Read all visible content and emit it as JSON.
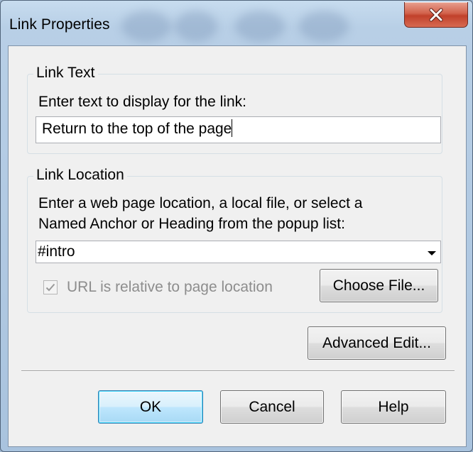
{
  "window": {
    "title": "Link Properties"
  },
  "link_text_group": {
    "title": "Link Text",
    "prompt": "Enter text to display for the link:",
    "value": "Return to the top of the page"
  },
  "link_location_group": {
    "title": "Link Location",
    "prompt_line1": "Enter a web page location, a local file, or select a",
    "prompt_line2": "Named Anchor or Heading from the popup list:",
    "location_value": "#intro",
    "relative_checkbox": {
      "label": "URL is relative to page location",
      "checked": true,
      "enabled": false
    },
    "choose_file_label": "Choose File..."
  },
  "buttons": {
    "advanced_edit": "Advanced Edit...",
    "ok": "OK",
    "cancel": "Cancel",
    "help": "Help"
  },
  "colors": {
    "dialog_bg": "#f0f0f0",
    "close_button": "#c1412b",
    "default_button_border": "#3c7fb1"
  }
}
